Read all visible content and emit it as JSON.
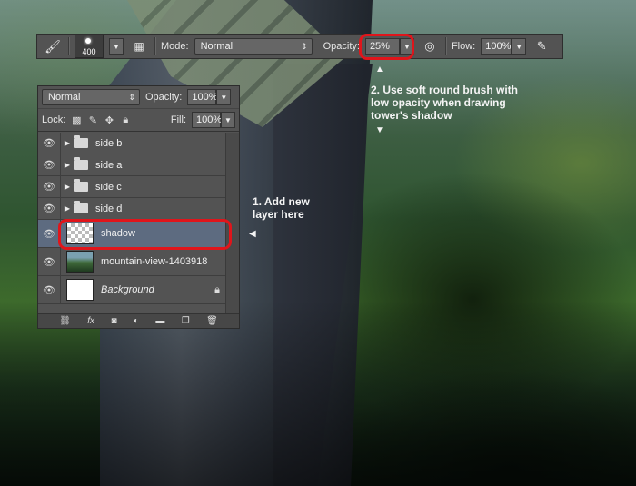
{
  "toolbar": {
    "brush_size": "400",
    "mode_label": "Mode:",
    "mode_value": "Normal",
    "opacity_label": "Opacity:",
    "opacity_value": "25%",
    "flow_label": "Flow:",
    "flow_value": "100%"
  },
  "layers_panel": {
    "blend_mode": "Normal",
    "opacity_label": "Opacity:",
    "opacity_value": "100%",
    "lock_label": "Lock:",
    "fill_label": "Fill:",
    "fill_value": "100%",
    "layers": [
      {
        "name": "side b",
        "type": "group"
      },
      {
        "name": "side a",
        "type": "group"
      },
      {
        "name": "side c",
        "type": "group"
      },
      {
        "name": "side d",
        "type": "group"
      },
      {
        "name": "shadow",
        "type": "layer",
        "selected": true
      },
      {
        "name": "mountain-view-1403918",
        "type": "layer"
      },
      {
        "name": "Background",
        "type": "background",
        "locked": true
      }
    ],
    "footer_fx": "fx"
  },
  "annotations": {
    "step1": "1. Add new layer here",
    "step2": "2. Use soft round brush with low opacity when drawing tower's shadow"
  },
  "colors": {
    "highlight_ring": "#e0151b",
    "selected_layer": "#5d6b80",
    "panel_bg": "#535353"
  }
}
